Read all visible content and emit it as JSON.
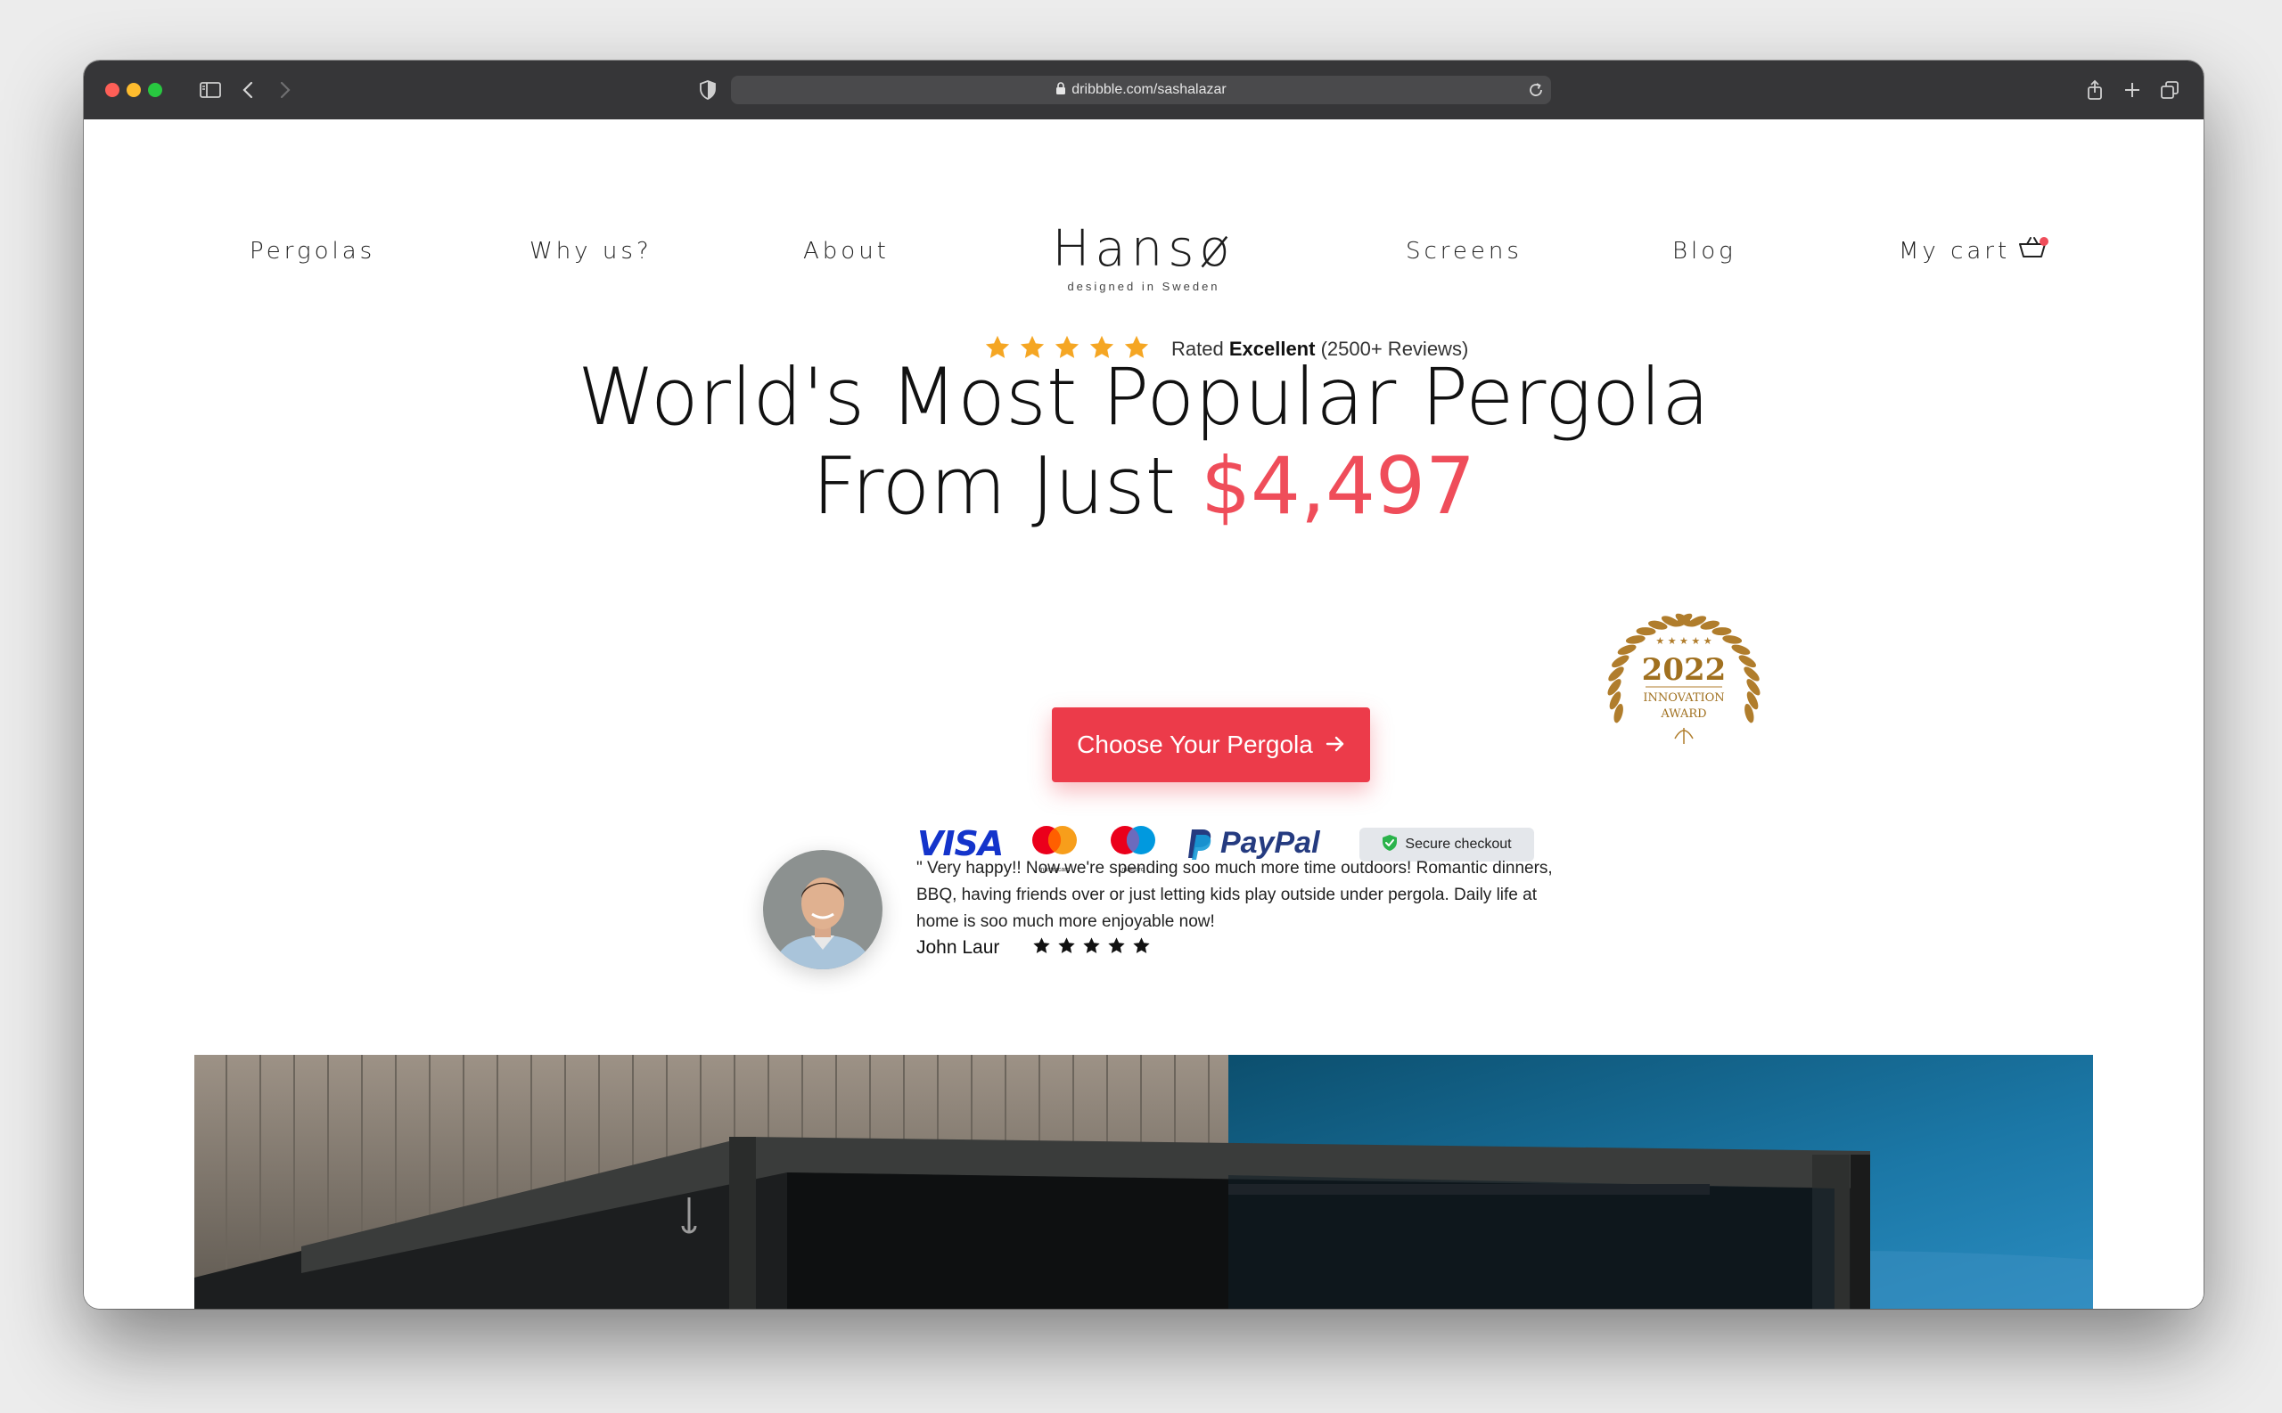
{
  "browser": {
    "url": "dribbble.com/sashalazar"
  },
  "nav": {
    "left": [
      "Pergolas",
      "Why us?",
      "About"
    ],
    "right": [
      "Screens",
      "Blog"
    ],
    "cart_label": "My cart"
  },
  "logo": {
    "name": "Hansø",
    "tagline": "designed in Sweden"
  },
  "rating": {
    "stars": 5,
    "prefix": "Rated",
    "emphasis": "Excellent",
    "suffix": "(2500+ Reviews)"
  },
  "headline": {
    "line1": "World's Most Popular Pergola",
    "line2_prefix": "From Just",
    "price": "$4,497"
  },
  "award": {
    "year": "2022",
    "line1": "INNOVATION",
    "line2": "AWARD"
  },
  "cta": {
    "label": "Choose Your Pergola"
  },
  "payments": {
    "visa": "VISA",
    "mastercard": "mastercard",
    "maestro": "maestro",
    "paypal": "PayPal",
    "secure": "Secure checkout"
  },
  "testimonial": {
    "quote": "\" Very happy!! Now we're spending soo much more time outdoors! Romantic dinners, BBQ, having friends over or just letting kids play outside under pergola. Daily life at home is soo much more enjoyable now!",
    "author": "John Laur",
    "stars": 5
  },
  "colors": {
    "accent": "#ec3b4a",
    "price": "#ef4d5a",
    "star_gold": "#f5a623",
    "award_gold": "#b07d2c"
  }
}
